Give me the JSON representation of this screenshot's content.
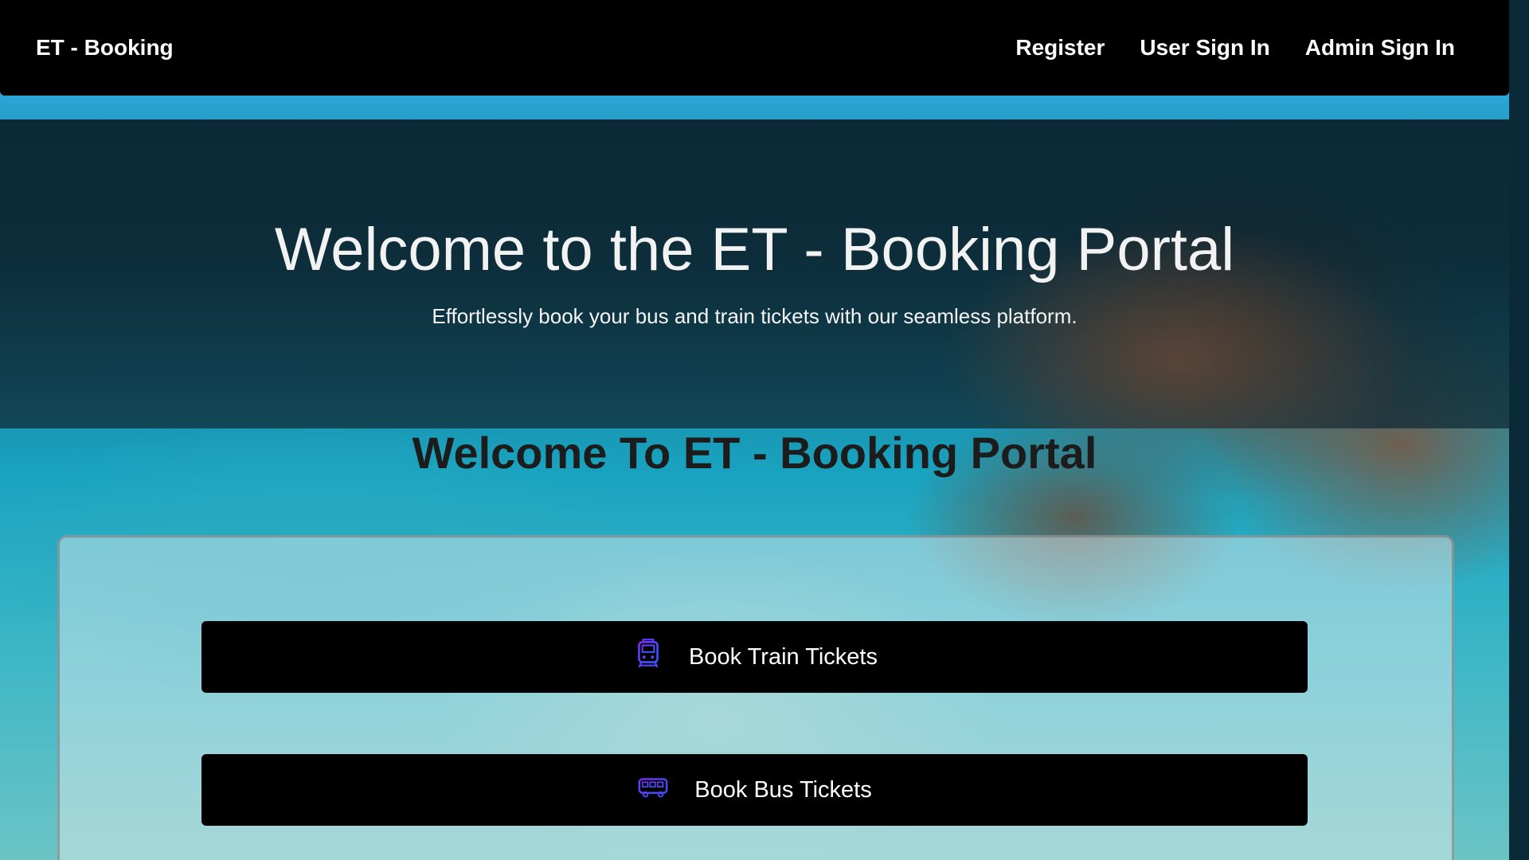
{
  "navbar": {
    "brand": "ET - Booking",
    "links": [
      "Register",
      "User Sign In",
      "Admin Sign In"
    ]
  },
  "hero": {
    "title": "Welcome to the ET - Booking Portal",
    "subtitle": "Effortlessly book your bus and train tickets with our seamless platform."
  },
  "section": {
    "heading": "Welcome To ET - Booking Portal"
  },
  "actions": {
    "train": {
      "label": "Book Train Tickets",
      "icon": "train-icon"
    },
    "bus": {
      "label": "Book Bus Tickets",
      "icon": "bus-icon"
    }
  },
  "colors": {
    "navbar": "#000000",
    "icon_gradient_start": "#7b2ff7",
    "icon_gradient_end": "#2f5bff"
  }
}
